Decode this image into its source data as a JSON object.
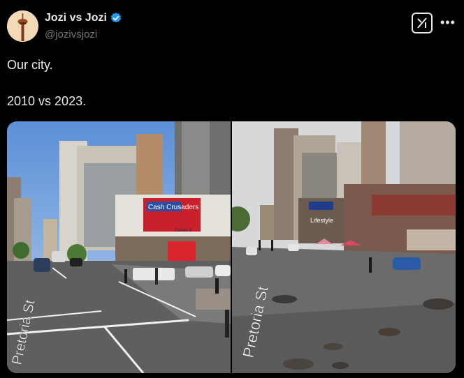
{
  "tweet": {
    "display_name": "Jozi vs Jozi",
    "handle": "@jozivsjozi",
    "verified": true,
    "text": "Our city.\n\n2010 vs 2023."
  },
  "media": {
    "left_street_sign": "Pretoria St",
    "left_billboard": "Cash Crusaders",
    "left_store": "Cover 8",
    "right_street_sign": "Pretoria St",
    "right_store": "Lifestyle"
  },
  "icons": {
    "verified": "verified-badge-icon",
    "grok": "grok-icon",
    "more": "more-icon"
  },
  "colors": {
    "background": "#000000",
    "text": "#e7e9ea",
    "secondary": "#71767b",
    "verified": "#1d9bf0"
  }
}
